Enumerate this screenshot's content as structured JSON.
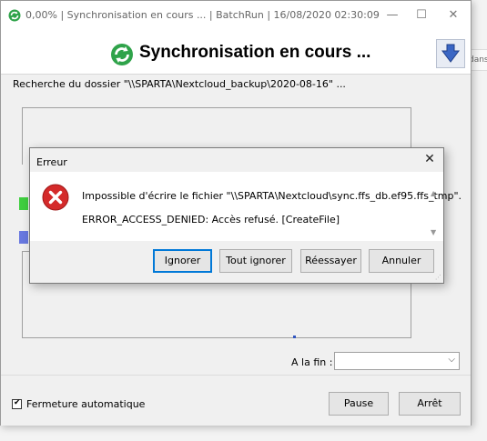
{
  "window": {
    "title": "0,00% | Synchronisation en cours ... | BatchRun | 16/08/2020 02:30:09",
    "min_glyph": "—",
    "max_glyph": "☐",
    "close_glyph": "✕"
  },
  "header": {
    "heading": "Synchronisation en cours ..."
  },
  "background": {
    "side_text": "dans"
  },
  "status": {
    "path_text": "Recherche du dossier \"\\\\SPARTA\\Nextcloud_backup\\2020-08-16\" ..."
  },
  "end_action": {
    "label": "A la fin :",
    "value": ""
  },
  "footer": {
    "auto_close_label": "Fermeture automatique",
    "auto_close_checked": true,
    "pause_label": "Pause",
    "stop_label": "Arrêt"
  },
  "dialog": {
    "title": "Erreur",
    "close_glyph": "✕",
    "message_line1": "Impossible d'écrire le fichier \"\\\\SPARTA\\Nextcloud\\sync.ffs_db.ef95.ffs_tmp\".",
    "message_line2": "ERROR_ACCESS_DENIED: Accès refusé. [CreateFile]",
    "buttons": {
      "ignore": "Ignorer",
      "ignore_all": "Tout ignorer",
      "retry": "Réessayer",
      "cancel": "Annuler"
    }
  },
  "colors": {
    "sync_green": "#2fa34a",
    "error_red": "#d42a2a",
    "focus_blue": "#0078d7",
    "progress_green": "#3fce3f",
    "progress_blue": "#6878e0"
  },
  "icons": {
    "app": "sync-icon",
    "header": "sync-icon",
    "arrow": "arrow-down-icon",
    "error": "error-icon"
  }
}
